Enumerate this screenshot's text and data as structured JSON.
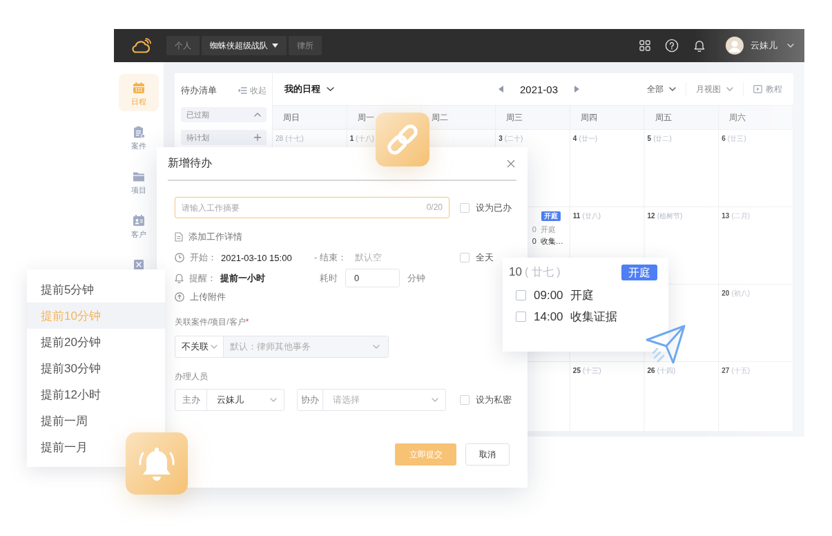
{
  "topbar": {
    "tabs": [
      {
        "label": "个人",
        "selected": false
      },
      {
        "label": "蜘蛛侠超级战队",
        "selected": true
      },
      {
        "label": "律所",
        "selected": false
      }
    ],
    "user": {
      "name": "云妹儿"
    }
  },
  "sidebar": {
    "items": [
      {
        "label": "日程",
        "selected": true
      },
      {
        "label": "案件",
        "selected": false
      },
      {
        "label": "项目",
        "selected": false
      },
      {
        "label": "客户",
        "selected": false
      },
      {
        "selected": false
      }
    ]
  },
  "todo_panel": {
    "title": "待办清单",
    "collapse": "收起",
    "groups": [
      {
        "label": "已过期",
        "expanded": true
      },
      {
        "label": "待计划",
        "expanded": false
      }
    ]
  },
  "calendar": {
    "scope": "我的日程",
    "month": "2021-03",
    "filters": [
      "全部",
      "月视图"
    ],
    "tutorial": "教程",
    "weekdays": [
      "周日",
      "周一",
      "周二",
      "周三",
      "周四",
      "周五",
      "周六"
    ],
    "weeks": [
      {
        "sunday": {
          "date": "28",
          "lunar": "(十七)",
          "in_month": false
        },
        "monday": {
          "date": "1",
          "lunar": "(十八)",
          "in_month": true
        },
        "wednesday": {
          "date": "3",
          "lunar": "(二十)",
          "in_month": true
        },
        "thursday": {
          "date": "4",
          "lunar": "(廿一)",
          "in_month": true
        },
        "friday": {
          "date": "5",
          "lunar": "(廿二)",
          "in_month": true
        },
        "saturday": {
          "date": "6",
          "lunar": "(廿三)",
          "in_month": true
        }
      },
      {
        "wednesday": {
          "badge": "开庭",
          "events": [
            {
              "time": "0",
              "title": "开庭",
              "past": true
            },
            {
              "time": "0",
              "title": "收集…",
              "past": false
            }
          ]
        },
        "thursday": {
          "date": "11",
          "lunar": "(廿八)",
          "in_month": true
        },
        "friday": {
          "date": "12",
          "lunar": "(植树节)",
          "in_month": true
        },
        "saturday": {
          "date": "13",
          "lunar": "(二月)",
          "in_month": true
        }
      },
      {
        "saturday": {
          "date": "20",
          "lunar": "(初八)",
          "in_month": true
        }
      },
      {
        "thursday": {
          "date": "25",
          "lunar": "(十三)",
          "in_month": true
        },
        "friday": {
          "date": "26",
          "lunar": "(十四)",
          "in_month": true
        },
        "saturday": {
          "date": "27",
          "lunar": "(十五)",
          "in_month": true
        }
      }
    ]
  },
  "dialog": {
    "title": "新增待办",
    "summary": {
      "placeholder": "请输入工作摘要",
      "counter": "0/20",
      "focused": true
    },
    "mark_done": {
      "label": "设为已办",
      "checked": false
    },
    "details_link": "添加工作详情",
    "start": {
      "label": "开始：",
      "value": "2021-03-10 15:00"
    },
    "end": {
      "label": "- 结束：",
      "placeholder": "默认空"
    },
    "all_day": {
      "label": "全天",
      "checked": false
    },
    "reminder": {
      "label": "提醒：",
      "value": "提前一小时"
    },
    "duration": {
      "label": "耗时",
      "value": "0",
      "unit": "分钟"
    },
    "upload": "上传附件",
    "relation": {
      "label": "关联案件/项目/客户",
      "required_mark": "*",
      "type_value": "不关联",
      "placeholder": "默认：律师其他事务",
      "disabled": true
    },
    "staff": {
      "label": "办理人员",
      "owner": {
        "label": "主办",
        "value": "云妹儿"
      },
      "assistant": {
        "label": "协办",
        "placeholder": "请选择"
      }
    },
    "private": {
      "label": "设为私密",
      "checked": false
    },
    "buttons": [
      {
        "label": "立即提交",
        "kind": "primary"
      },
      {
        "label": "取消",
        "kind": "default"
      }
    ]
  },
  "reminder_menu": {
    "items": [
      {
        "label": "提前5分钟",
        "selected": false
      },
      {
        "label": "提前10分钟",
        "selected": true
      },
      {
        "label": "提前20分钟",
        "selected": false
      },
      {
        "label": "提前30分钟",
        "selected": false
      },
      {
        "label": "提前12小时",
        "selected": false
      },
      {
        "label": "提前一周",
        "selected": false
      },
      {
        "label": "提前一月",
        "selected": false
      }
    ]
  },
  "day_popover": {
    "date": "10",
    "lunar": "( 廿七 )",
    "badge": "开庭",
    "items": [
      {
        "time": "09:00",
        "title": "开庭",
        "checked": false
      },
      {
        "time": "14:00",
        "title": "收集证据",
        "checked": false
      }
    ]
  }
}
